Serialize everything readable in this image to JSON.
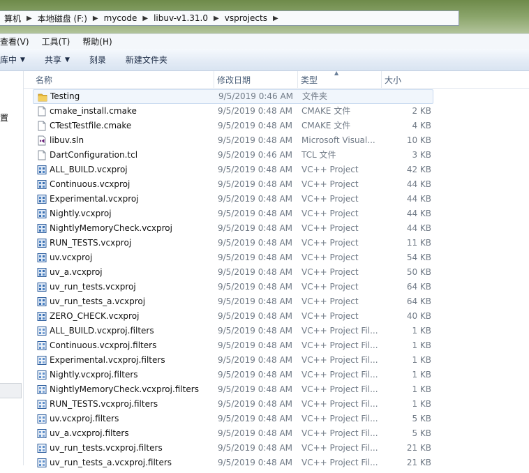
{
  "address": {
    "crumbs": [
      "算机",
      "本地磁盘 (F:)",
      "mycode",
      "libuv-v1.31.0",
      "vsprojects"
    ]
  },
  "menu": [
    "查看(V)",
    "工具(T)",
    "帮助(H)"
  ],
  "toolbar": {
    "include_library": "库中",
    "share": "共享",
    "burn": "刻录",
    "new_folder": "新建文件夹"
  },
  "nav": {
    "item": "置"
  },
  "columns": {
    "name": "名称",
    "date": "修改日期",
    "type": "类型",
    "size": "大小"
  },
  "files": [
    {
      "name": "Testing",
      "date": "9/5/2019 0:46 AM",
      "type": "文件夹",
      "size": "",
      "icon": "folder-icon",
      "selected": true
    },
    {
      "name": "cmake_install.cmake",
      "date": "9/5/2019 0:48 AM",
      "type": "CMAKE 文件",
      "size": "2 KB",
      "icon": "document-icon"
    },
    {
      "name": "CTestTestfile.cmake",
      "date": "9/5/2019 0:48 AM",
      "type": "CMAKE 文件",
      "size": "4 KB",
      "icon": "document-icon"
    },
    {
      "name": "libuv.sln",
      "date": "9/5/2019 0:48 AM",
      "type": "Microsoft Visual...",
      "size": "10 KB",
      "icon": "visual-studio-solution-icon"
    },
    {
      "name": "DartConfiguration.tcl",
      "date": "9/5/2019 0:46 AM",
      "type": "TCL 文件",
      "size": "3 KB",
      "icon": "document-icon"
    },
    {
      "name": "ALL_BUILD.vcxproj",
      "date": "9/5/2019 0:48 AM",
      "type": "VC++ Project",
      "size": "42 KB",
      "icon": "vcxproj-icon"
    },
    {
      "name": "Continuous.vcxproj",
      "date": "9/5/2019 0:48 AM",
      "type": "VC++ Project",
      "size": "44 KB",
      "icon": "vcxproj-icon"
    },
    {
      "name": "Experimental.vcxproj",
      "date": "9/5/2019 0:48 AM",
      "type": "VC++ Project",
      "size": "44 KB",
      "icon": "vcxproj-icon"
    },
    {
      "name": "Nightly.vcxproj",
      "date": "9/5/2019 0:48 AM",
      "type": "VC++ Project",
      "size": "44 KB",
      "icon": "vcxproj-icon"
    },
    {
      "name": "NightlyMemoryCheck.vcxproj",
      "date": "9/5/2019 0:48 AM",
      "type": "VC++ Project",
      "size": "44 KB",
      "icon": "vcxproj-icon"
    },
    {
      "name": "RUN_TESTS.vcxproj",
      "date": "9/5/2019 0:48 AM",
      "type": "VC++ Project",
      "size": "11 KB",
      "icon": "vcxproj-icon"
    },
    {
      "name": "uv.vcxproj",
      "date": "9/5/2019 0:48 AM",
      "type": "VC++ Project",
      "size": "54 KB",
      "icon": "vcxproj-icon"
    },
    {
      "name": "uv_a.vcxproj",
      "date": "9/5/2019 0:48 AM",
      "type": "VC++ Project",
      "size": "50 KB",
      "icon": "vcxproj-icon"
    },
    {
      "name": "uv_run_tests.vcxproj",
      "date": "9/5/2019 0:48 AM",
      "type": "VC++ Project",
      "size": "64 KB",
      "icon": "vcxproj-icon"
    },
    {
      "name": "uv_run_tests_a.vcxproj",
      "date": "9/5/2019 0:48 AM",
      "type": "VC++ Project",
      "size": "64 KB",
      "icon": "vcxproj-icon"
    },
    {
      "name": "ZERO_CHECK.vcxproj",
      "date": "9/5/2019 0:48 AM",
      "type": "VC++ Project",
      "size": "40 KB",
      "icon": "vcxproj-icon"
    },
    {
      "name": "ALL_BUILD.vcxproj.filters",
      "date": "9/5/2019 0:48 AM",
      "type": "VC++ Project Fil...",
      "size": "1 KB",
      "icon": "vcxproj-filters-icon"
    },
    {
      "name": "Continuous.vcxproj.filters",
      "date": "9/5/2019 0:48 AM",
      "type": "VC++ Project Fil...",
      "size": "1 KB",
      "icon": "vcxproj-filters-icon"
    },
    {
      "name": "Experimental.vcxproj.filters",
      "date": "9/5/2019 0:48 AM",
      "type": "VC++ Project Fil...",
      "size": "1 KB",
      "icon": "vcxproj-filters-icon"
    },
    {
      "name": "Nightly.vcxproj.filters",
      "date": "9/5/2019 0:48 AM",
      "type": "VC++ Project Fil...",
      "size": "1 KB",
      "icon": "vcxproj-filters-icon"
    },
    {
      "name": "NightlyMemoryCheck.vcxproj.filters",
      "date": "9/5/2019 0:48 AM",
      "type": "VC++ Project Fil...",
      "size": "1 KB",
      "icon": "vcxproj-filters-icon"
    },
    {
      "name": "RUN_TESTS.vcxproj.filters",
      "date": "9/5/2019 0:48 AM",
      "type": "VC++ Project Fil...",
      "size": "1 KB",
      "icon": "vcxproj-filters-icon"
    },
    {
      "name": "uv.vcxproj.filters",
      "date": "9/5/2019 0:48 AM",
      "type": "VC++ Project Fil...",
      "size": "5 KB",
      "icon": "vcxproj-filters-icon"
    },
    {
      "name": "uv_a.vcxproj.filters",
      "date": "9/5/2019 0:48 AM",
      "type": "VC++ Project Fil...",
      "size": "5 KB",
      "icon": "vcxproj-filters-icon"
    },
    {
      "name": "uv_run_tests.vcxproj.filters",
      "date": "9/5/2019 0:48 AM",
      "type": "VC++ Project Fil...",
      "size": "21 KB",
      "icon": "vcxproj-filters-icon"
    },
    {
      "name": "uv_run_tests_a.vcxproj.filters",
      "date": "9/5/2019 0:48 AM",
      "type": "VC++ Project Fil...",
      "size": "21 KB",
      "icon": "vcxproj-filters-icon"
    }
  ],
  "colors": {
    "folder": "#e8b93c",
    "vs_purple": "#68217a",
    "vcx_blue": "#2f5f9e",
    "selection": "#c7d9ef"
  }
}
